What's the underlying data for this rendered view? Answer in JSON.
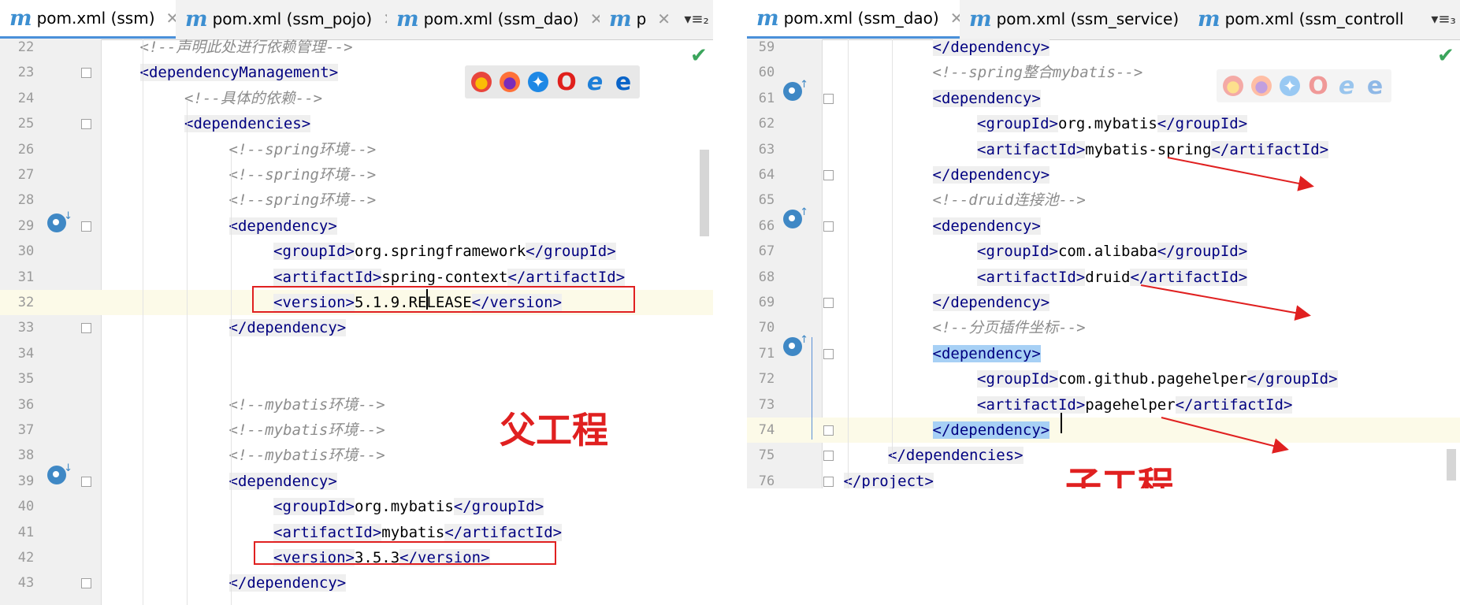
{
  "left_editor": {
    "tabs": [
      {
        "label": "pom.xml (ssm)",
        "active": true
      },
      {
        "label": "pom.xml (ssm_pojo)",
        "active": false
      },
      {
        "label": "pom.xml (ssm_dao)",
        "active": false
      },
      {
        "label": "p",
        "active": false
      }
    ],
    "tab_more": "▾≡₂",
    "lines": [
      {
        "n": "22",
        "indent": 1,
        "parts": [
          [
            "cm",
            "<!--声明此处进行依赖管理-->"
          ]
        ]
      },
      {
        "n": "23",
        "indent": 1,
        "parts": [
          [
            "tag",
            "<dependencyManagement>"
          ]
        ]
      },
      {
        "n": "24",
        "indent": 2,
        "parts": [
          [
            "cm",
            "<!--具体的依赖-->"
          ]
        ]
      },
      {
        "n": "25",
        "indent": 2,
        "parts": [
          [
            "tag",
            "<dependencies>"
          ]
        ]
      },
      {
        "n": "26",
        "indent": 3,
        "parts": [
          [
            "cm",
            "<!--spring环境-->"
          ]
        ]
      },
      {
        "n": "27",
        "indent": 3,
        "parts": [
          [
            "cm",
            "<!--spring环境-->"
          ]
        ]
      },
      {
        "n": "28",
        "indent": 3,
        "parts": [
          [
            "cm",
            "<!--spring环境-->"
          ]
        ]
      },
      {
        "n": "29",
        "indent": 3,
        "parts": [
          [
            "tag",
            "<dependency>"
          ]
        ]
      },
      {
        "n": "30",
        "indent": 4,
        "parts": [
          [
            "tag",
            "<groupId>"
          ],
          [
            "txt",
            "org.springframework"
          ],
          [
            "tag",
            "</groupId>"
          ]
        ]
      },
      {
        "n": "31",
        "indent": 4,
        "parts": [
          [
            "tag",
            "<artifactId>"
          ],
          [
            "txt",
            "spring-context"
          ],
          [
            "tag",
            "</artifactId>"
          ]
        ]
      },
      {
        "n": "32",
        "indent": 4,
        "parts": [
          [
            "tag",
            "<version>"
          ],
          [
            "txt",
            "5.1.9.RELEASE"
          ],
          [
            "tag",
            "</version>"
          ]
        ]
      },
      {
        "n": "33",
        "indent": 3,
        "parts": [
          [
            "tag",
            "</dependency>"
          ]
        ]
      },
      {
        "n": "34",
        "indent": 0,
        "parts": []
      },
      {
        "n": "35",
        "indent": 0,
        "parts": []
      },
      {
        "n": "36",
        "indent": 3,
        "parts": [
          [
            "cm",
            "<!--mybatis环境-->"
          ]
        ]
      },
      {
        "n": "37",
        "indent": 3,
        "parts": [
          [
            "cm",
            "<!--mybatis环境-->"
          ]
        ]
      },
      {
        "n": "38",
        "indent": 3,
        "parts": [
          [
            "cm",
            "<!--mybatis环境-->"
          ]
        ]
      },
      {
        "n": "39",
        "indent": 3,
        "parts": [
          [
            "tag",
            "<dependency>"
          ]
        ]
      },
      {
        "n": "40",
        "indent": 4,
        "parts": [
          [
            "tag",
            "<groupId>"
          ],
          [
            "txt",
            "org.mybatis"
          ],
          [
            "tag",
            "</groupId>"
          ]
        ]
      },
      {
        "n": "41",
        "indent": 4,
        "parts": [
          [
            "tag",
            "<artifactId>"
          ],
          [
            "txt",
            "mybatis"
          ],
          [
            "tag",
            "</artifactId>"
          ]
        ]
      },
      {
        "n": "42",
        "indent": 4,
        "parts": [
          [
            "tag",
            "<version>"
          ],
          [
            "txt",
            "3.5.3"
          ],
          [
            "tag",
            "</version>"
          ]
        ]
      },
      {
        "n": "43",
        "indent": 3,
        "parts": [
          [
            "tag",
            "</dependency>"
          ]
        ]
      }
    ],
    "annotation": "父工程"
  },
  "right_editor": {
    "tabs": [
      {
        "label": "pom.xml (ssm_dao)",
        "active": true
      },
      {
        "label": "pom.xml (ssm_service)",
        "active": false
      },
      {
        "label": "pom.xml (ssm_controll",
        "active": false
      }
    ],
    "tab_more": "▾≡₃",
    "lines": [
      {
        "n": "59",
        "indent": 3,
        "parts": [
          [
            "tag",
            "</dependency>"
          ]
        ]
      },
      {
        "n": "60",
        "indent": 3,
        "parts": [
          [
            "cm",
            "<!--spring整合mybatis-->"
          ]
        ]
      },
      {
        "n": "61",
        "indent": 3,
        "parts": [
          [
            "tag",
            "<dependency>"
          ]
        ]
      },
      {
        "n": "62",
        "indent": 4,
        "parts": [
          [
            "tag",
            "<groupId>"
          ],
          [
            "txt",
            "org.mybatis"
          ],
          [
            "tag",
            "</groupId>"
          ]
        ]
      },
      {
        "n": "63",
        "indent": 4,
        "parts": [
          [
            "tag",
            "<artifactId>"
          ],
          [
            "txt",
            "mybatis-spring"
          ],
          [
            "tag",
            "</artifactId>"
          ]
        ]
      },
      {
        "n": "64",
        "indent": 3,
        "parts": [
          [
            "tag",
            "</dependency>"
          ]
        ]
      },
      {
        "n": "65",
        "indent": 3,
        "parts": [
          [
            "cm",
            "<!--druid连接池-->"
          ]
        ]
      },
      {
        "n": "66",
        "indent": 3,
        "parts": [
          [
            "tag",
            "<dependency>"
          ]
        ]
      },
      {
        "n": "67",
        "indent": 4,
        "parts": [
          [
            "tag",
            "<groupId>"
          ],
          [
            "txt",
            "com.alibaba"
          ],
          [
            "tag",
            "</groupId>"
          ]
        ]
      },
      {
        "n": "68",
        "indent": 4,
        "parts": [
          [
            "tag",
            "<artifactId>"
          ],
          [
            "txt",
            "druid"
          ],
          [
            "tag",
            "</artifactId>"
          ]
        ]
      },
      {
        "n": "69",
        "indent": 3,
        "parts": [
          [
            "tag",
            "</dependency>"
          ]
        ]
      },
      {
        "n": "70",
        "indent": 3,
        "parts": [
          [
            "cm",
            "<!--分页插件坐标-->"
          ]
        ]
      },
      {
        "n": "71",
        "indent": 3,
        "parts": [
          [
            "taghl",
            "<dependency>"
          ]
        ]
      },
      {
        "n": "72",
        "indent": 4,
        "parts": [
          [
            "tag",
            "<groupId>"
          ],
          [
            "txt",
            "com.github.pagehelper"
          ],
          [
            "tag",
            "</groupId>"
          ]
        ]
      },
      {
        "n": "73",
        "indent": 4,
        "parts": [
          [
            "tag",
            "<artifactId>"
          ],
          [
            "txt",
            "pagehelper"
          ],
          [
            "tag",
            "</artifactId>"
          ]
        ]
      },
      {
        "n": "74",
        "indent": 3,
        "parts": [
          [
            "taghl",
            "</dependency>"
          ]
        ]
      },
      {
        "n": "75",
        "indent": 2,
        "parts": [
          [
            "tag",
            "</dependencies>"
          ]
        ]
      },
      {
        "n": "76",
        "indent": 1,
        "parts": [
          [
            "tag",
            "</project>"
          ]
        ]
      }
    ],
    "annotation": "子工程"
  },
  "browser_icons": [
    "chrome-icon",
    "firefox-icon",
    "safari-icon",
    "opera-icon",
    "ie-icon",
    "edge-icon"
  ],
  "colors": {
    "tag": "#000080",
    "comment": "#8c8c8c",
    "annotation": "#e02020",
    "tab_accent": "#4a90d9"
  }
}
